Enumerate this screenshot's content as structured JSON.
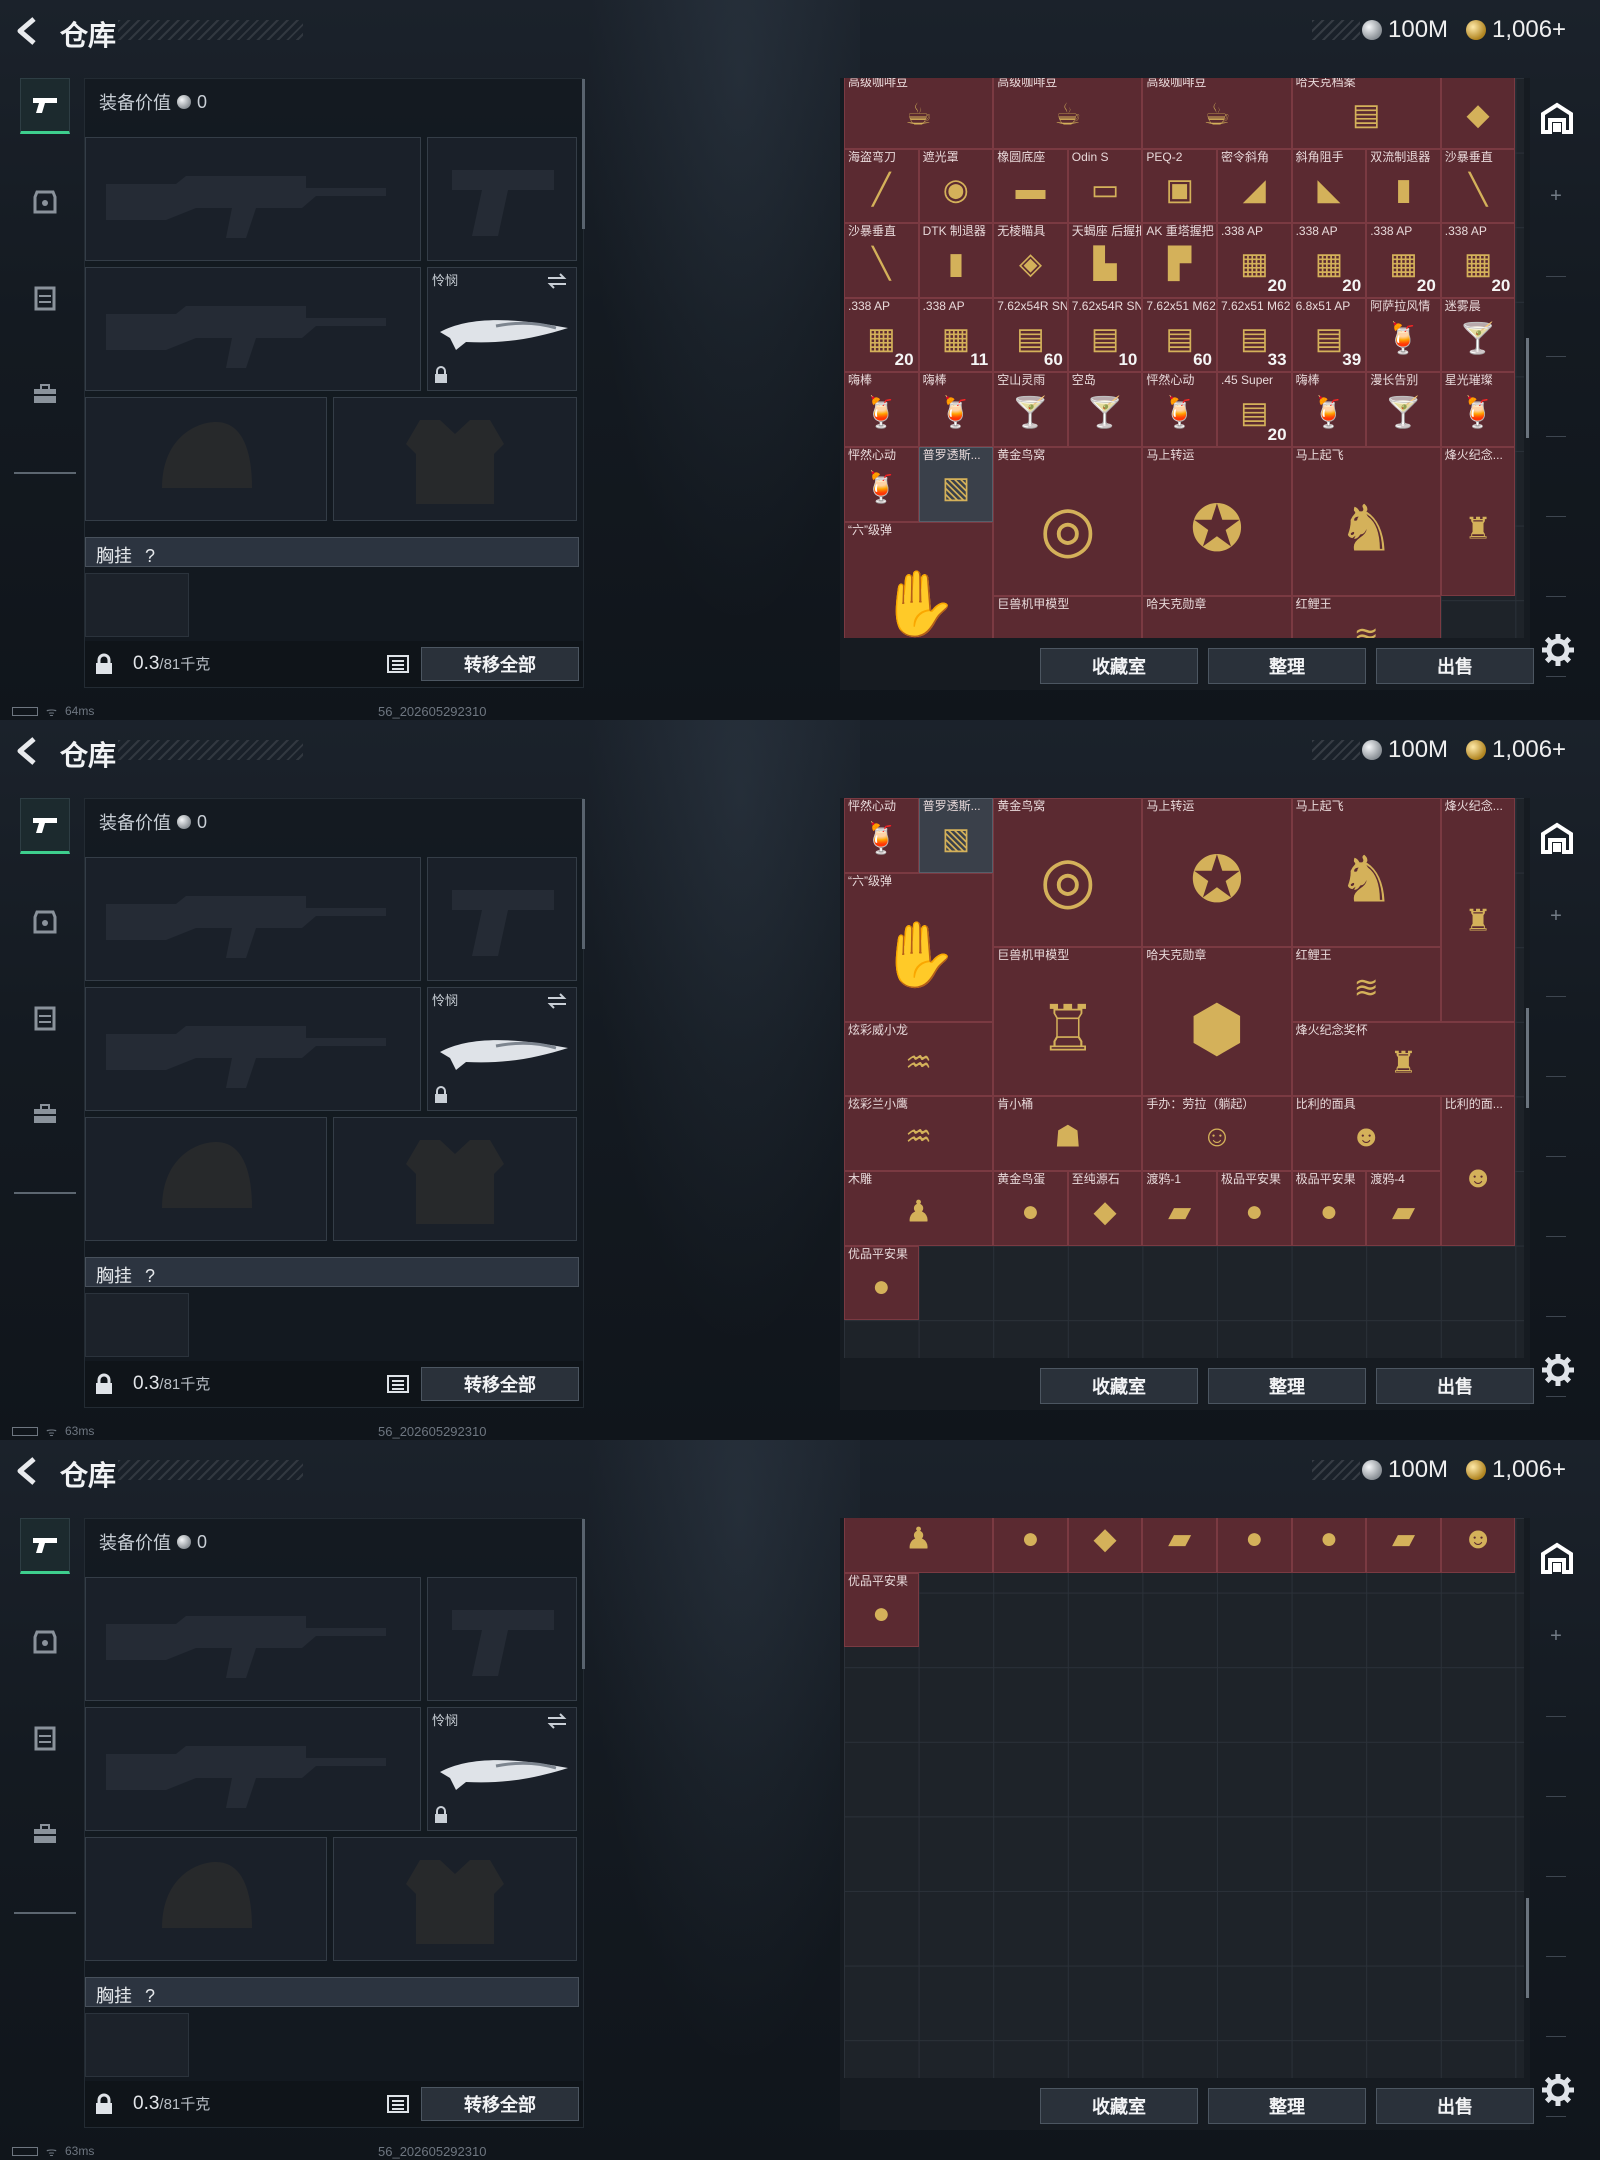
{
  "header": {
    "title": "仓库",
    "silver": "100M",
    "gold": "1,006+"
  },
  "equip": {
    "value_label": "装备价值",
    "value": "0",
    "melee_label": "怜悯",
    "chest_label": "胸挂",
    "chest_help": "?",
    "weight": "0.3",
    "weight_max": "/81千克",
    "transfer_all": "转移全部"
  },
  "buttons": {
    "collection": "收藏室",
    "organize": "整理",
    "sell": "出售"
  },
  "status": {
    "ping1": "64ms",
    "ping2": "63ms",
    "ping3": "63ms",
    "build": "56_202605292310"
  },
  "screens": [
    {
      "cells": [
        {
          "n": "高级咖啡豆",
          "c": "",
          "r": 0,
          "col": 0,
          "w": 2,
          "h": 1,
          "k": "☕"
        },
        {
          "n": "高级咖啡豆",
          "c": "",
          "r": 0,
          "col": 2,
          "w": 2,
          "h": 1,
          "k": "☕"
        },
        {
          "n": "高级咖啡豆",
          "c": "",
          "r": 0,
          "col": 4,
          "w": 2,
          "h": 1,
          "k": "☕"
        },
        {
          "n": "哈夫克档案",
          "c": "",
          "r": 0,
          "col": 6,
          "w": 2,
          "h": 1,
          "k": "▤"
        },
        {
          "n": "",
          "c": "",
          "r": 0,
          "col": 8,
          "w": 1,
          "h": 1,
          "k": "◆"
        },
        {
          "n": "海盗弯刀",
          "c": "",
          "r": 1,
          "col": 0,
          "w": 1,
          "h": 1,
          "k": "╱"
        },
        {
          "n": "遮光罩",
          "c": "",
          "r": 1,
          "col": 1,
          "w": 1,
          "h": 1,
          "k": "◉"
        },
        {
          "n": "橡圆底座",
          "c": "",
          "r": 1,
          "col": 2,
          "w": 1,
          "h": 1,
          "k": "▬"
        },
        {
          "n": "Odin S",
          "c": "",
          "r": 1,
          "col": 3,
          "w": 1,
          "h": 1,
          "k": "▭"
        },
        {
          "n": "PEQ-2",
          "c": "",
          "r": 1,
          "col": 4,
          "w": 1,
          "h": 1,
          "k": "▣"
        },
        {
          "n": "密令斜角",
          "c": "",
          "r": 1,
          "col": 5,
          "w": 1,
          "h": 1,
          "k": "◢"
        },
        {
          "n": "斜角阻手",
          "c": "",
          "r": 1,
          "col": 6,
          "w": 1,
          "h": 1,
          "k": "◣"
        },
        {
          "n": "双流制退器",
          "c": "",
          "r": 1,
          "col": 7,
          "w": 1,
          "h": 1,
          "k": "▮"
        },
        {
          "n": "沙暴垂直",
          "c": "",
          "r": 1,
          "col": 8,
          "w": 1,
          "h": 1,
          "k": "╲"
        },
        {
          "n": "沙暴垂直",
          "c": "",
          "r": 2,
          "col": 0,
          "w": 1,
          "h": 1,
          "k": "╲"
        },
        {
          "n": "DTK 制退器",
          "c": "",
          "r": 2,
          "col": 1,
          "w": 1,
          "h": 1,
          "k": "▮"
        },
        {
          "n": "无棱瞄具",
          "c": "",
          "r": 2,
          "col": 2,
          "w": 1,
          "h": 1,
          "k": "◈"
        },
        {
          "n": "天蝎座 后握把",
          "c": "",
          "r": 2,
          "col": 3,
          "w": 1,
          "h": 1,
          "k": "▙"
        },
        {
          "n": "AK 重塔握把",
          "c": "",
          "r": 2,
          "col": 4,
          "w": 1,
          "h": 1,
          "k": "▛"
        },
        {
          "n": ".338 AP",
          "c": "20",
          "r": 2,
          "col": 5,
          "w": 1,
          "h": 1,
          "k": "▦"
        },
        {
          "n": ".338 AP",
          "c": "20",
          "r": 2,
          "col": 6,
          "w": 1,
          "h": 1,
          "k": "▦"
        },
        {
          "n": ".338 AP",
          "c": "20",
          "r": 2,
          "col": 7,
          "w": 1,
          "h": 1,
          "k": "▦"
        },
        {
          "n": ".338 AP",
          "c": "20",
          "r": 2,
          "col": 8,
          "w": 1,
          "h": 1,
          "k": "▦"
        },
        {
          "n": ".338 AP",
          "c": "20",
          "r": 3,
          "col": 0,
          "w": 1,
          "h": 1,
          "k": "▦"
        },
        {
          "n": ".338 AP",
          "c": "11",
          "r": 3,
          "col": 1,
          "w": 1,
          "h": 1,
          "k": "▦"
        },
        {
          "n": "7.62x54R SNB",
          "c": "60",
          "r": 3,
          "col": 2,
          "w": 1,
          "h": 1,
          "k": "▤"
        },
        {
          "n": "7.62x54R SNB",
          "c": "10",
          "r": 3,
          "col": 3,
          "w": 1,
          "h": 1,
          "k": "▤"
        },
        {
          "n": "7.62x51 M62",
          "c": "60",
          "r": 3,
          "col": 4,
          "w": 1,
          "h": 1,
          "k": "▤"
        },
        {
          "n": "7.62x51 M62",
          "c": "33",
          "r": 3,
          "col": 5,
          "w": 1,
          "h": 1,
          "k": "▤"
        },
        {
          "n": "6.8x51 AP",
          "c": "39",
          "r": 3,
          "col": 6,
          "w": 1,
          "h": 1,
          "k": "▤"
        },
        {
          "n": "阿萨拉风情",
          "c": "",
          "r": 3,
          "col": 7,
          "w": 1,
          "h": 1,
          "k": "🍹"
        },
        {
          "n": "迷雾晨",
          "c": "",
          "r": 3,
          "col": 8,
          "w": 1,
          "h": 1,
          "k": "🍸"
        },
        {
          "n": "嗨棒",
          "c": "",
          "r": 4,
          "col": 0,
          "w": 1,
          "h": 1,
          "k": "🍹"
        },
        {
          "n": "嗨棒",
          "c": "",
          "r": 4,
          "col": 1,
          "w": 1,
          "h": 1,
          "k": "🍹"
        },
        {
          "n": "空山灵雨",
          "c": "",
          "r": 4,
          "col": 2,
          "w": 1,
          "h": 1,
          "k": "🍸"
        },
        {
          "n": "空岛",
          "c": "",
          "r": 4,
          "col": 3,
          "w": 1,
          "h": 1,
          "k": "🍸"
        },
        {
          "n": "怦然心动",
          "c": "",
          "r": 4,
          "col": 4,
          "w": 1,
          "h": 1,
          "k": "🍹"
        },
        {
          "n": ".45 Super",
          "c": "20",
          "r": 4,
          "col": 5,
          "w": 1,
          "h": 1,
          "k": "▤"
        },
        {
          "n": "嗨棒",
          "c": "",
          "r": 4,
          "col": 6,
          "w": 1,
          "h": 1,
          "k": "🍹"
        },
        {
          "n": "漫长告别",
          "c": "",
          "r": 4,
          "col": 7,
          "w": 1,
          "h": 1,
          "k": "🍸"
        },
        {
          "n": "星光璀璨",
          "c": "",
          "r": 4,
          "col": 8,
          "w": 1,
          "h": 1,
          "k": "🍹"
        },
        {
          "n": "怦然心动",
          "c": "",
          "r": 5,
          "col": 0,
          "w": 1,
          "h": 1,
          "k": "🍹"
        },
        {
          "n": "普罗透斯...",
          "c": "",
          "r": 5,
          "col": 1,
          "w": 1,
          "h": 1,
          "k": "▧",
          "g": true
        },
        {
          "n": "黄金鸟窝",
          "c": "",
          "r": 5,
          "col": 2,
          "w": 2,
          "h": 2,
          "k": "◎"
        },
        {
          "n": "马上转运",
          "c": "",
          "r": 5,
          "col": 4,
          "w": 2,
          "h": 2,
          "k": "✪"
        },
        {
          "n": "马上起飞",
          "c": "",
          "r": 5,
          "col": 6,
          "w": 2,
          "h": 2,
          "k": "♞"
        },
        {
          "n": "烽火纪念...",
          "c": "",
          "r": 5,
          "col": 8,
          "w": 1,
          "h": 2,
          "k": "♜"
        },
        {
          "n": "“六”级弹",
          "c": "",
          "r": 6,
          "col": 0,
          "w": 2,
          "h": 2,
          "k": "✋"
        },
        {
          "n": "巨兽机甲模型",
          "c": "",
          "r": 7,
          "col": 2,
          "w": 2,
          "h": 2,
          "k": "♖"
        },
        {
          "n": "哈夫克勋章",
          "c": "",
          "r": 7,
          "col": 4,
          "w": 2,
          "h": 2,
          "k": "⬢"
        },
        {
          "n": "红鲤王",
          "c": "",
          "r": 7,
          "col": 6,
          "w": 2,
          "h": 1,
          "k": "≋"
        }
      ]
    },
    {
      "cells": [
        {
          "n": "怦然心动",
          "c": "",
          "r": 0,
          "col": 0,
          "w": 1,
          "h": 1,
          "k": "🍹"
        },
        {
          "n": "普罗透斯...",
          "c": "",
          "r": 0,
          "col": 1,
          "w": 1,
          "h": 1,
          "k": "▧",
          "g": true
        },
        {
          "n": "黄金鸟窝",
          "c": "",
          "r": 0,
          "col": 2,
          "w": 2,
          "h": 2,
          "k": "◎"
        },
        {
          "n": "马上转运",
          "c": "",
          "r": 0,
          "col": 4,
          "w": 2,
          "h": 2,
          "k": "✪"
        },
        {
          "n": "马上起飞",
          "c": "",
          "r": 0,
          "col": 6,
          "w": 2,
          "h": 2,
          "k": "♞"
        },
        {
          "n": "烽火纪念...",
          "c": "",
          "r": 0,
          "col": 8,
          "w": 1,
          "h": 3,
          "k": "♜"
        },
        {
          "n": "“六”级弹",
          "c": "",
          "r": 1,
          "col": 0,
          "w": 2,
          "h": 2,
          "k": "✋"
        },
        {
          "n": "巨兽机甲模型",
          "c": "",
          "r": 2,
          "col": 2,
          "w": 2,
          "h": 2,
          "k": "♖"
        },
        {
          "n": "哈夫克勋章",
          "c": "",
          "r": 2,
          "col": 4,
          "w": 2,
          "h": 2,
          "k": "⬢"
        },
        {
          "n": "红鲤王",
          "c": "",
          "r": 2,
          "col": 6,
          "w": 2,
          "h": 1,
          "k": "≋"
        },
        {
          "n": "炫彩威小龙",
          "c": "",
          "r": 3,
          "col": 0,
          "w": 2,
          "h": 1,
          "k": "♒"
        },
        {
          "n": "烽火纪念奖杯",
          "c": "",
          "r": 3,
          "col": 6,
          "w": 3,
          "h": 1,
          "k": "♜"
        },
        {
          "n": "炫彩兰小鹰",
          "c": "",
          "r": 4,
          "col": 0,
          "w": 2,
          "h": 1,
          "k": "♒"
        },
        {
          "n": "肯小桶",
          "c": "",
          "r": 4,
          "col": 2,
          "w": 2,
          "h": 1,
          "k": "☗"
        },
        {
          "n": "手办：劳拉（躺起）",
          "c": "",
          "r": 4,
          "col": 4,
          "w": 2,
          "h": 1,
          "k": "☺"
        },
        {
          "n": "比利的面具",
          "c": "",
          "r": 4,
          "col": 6,
          "w": 2,
          "h": 1,
          "k": "☻"
        },
        {
          "n": "比利的面...",
          "c": "",
          "r": 4,
          "col": 8,
          "w": 1,
          "h": 2,
          "k": "☻"
        },
        {
          "n": "木雕",
          "c": "",
          "r": 5,
          "col": 0,
          "w": 2,
          "h": 1,
          "k": "♟"
        },
        {
          "n": "黄金鸟蛋",
          "c": "",
          "r": 5,
          "col": 2,
          "w": 1,
          "h": 1,
          "k": "●"
        },
        {
          "n": "至纯源石",
          "c": "",
          "r": 5,
          "col": 3,
          "w": 1,
          "h": 1,
          "k": "◆"
        },
        {
          "n": "渡鸦-1",
          "c": "",
          "r": 5,
          "col": 4,
          "w": 1,
          "h": 1,
          "k": "▰"
        },
        {
          "n": "极品平安果",
          "c": "",
          "r": 5,
          "col": 5,
          "w": 1,
          "h": 1,
          "k": "●"
        },
        {
          "n": "极品平安果",
          "c": "",
          "r": 5,
          "col": 6,
          "w": 1,
          "h": 1,
          "k": "●"
        },
        {
          "n": "渡鸦-4",
          "c": "",
          "r": 5,
          "col": 7,
          "w": 1,
          "h": 1,
          "k": "▰"
        },
        {
          "n": "优品平安果",
          "c": "",
          "r": 6,
          "col": 0,
          "w": 1,
          "h": 1,
          "k": "●"
        }
      ]
    },
    {
      "cells": [
        {
          "n": "",
          "c": "",
          "r": 0,
          "col": 0,
          "w": 2,
          "h": 1,
          "k": "♟"
        },
        {
          "n": "",
          "c": "",
          "r": 0,
          "col": 2,
          "w": 1,
          "h": 1,
          "k": "●"
        },
        {
          "n": "",
          "c": "",
          "r": 0,
          "col": 3,
          "w": 1,
          "h": 1,
          "k": "◆"
        },
        {
          "n": "",
          "c": "",
          "r": 0,
          "col": 4,
          "w": 1,
          "h": 1,
          "k": "▰"
        },
        {
          "n": "",
          "c": "",
          "r": 0,
          "col": 5,
          "w": 1,
          "h": 1,
          "k": "●"
        },
        {
          "n": "",
          "c": "",
          "r": 0,
          "col": 6,
          "w": 1,
          "h": 1,
          "k": "●"
        },
        {
          "n": "",
          "c": "",
          "r": 0,
          "col": 7,
          "w": 1,
          "h": 1,
          "k": "▰"
        },
        {
          "n": "",
          "c": "",
          "r": 0,
          "col": 8,
          "w": 1,
          "h": 1,
          "k": "☻"
        },
        {
          "n": "优品平安果",
          "c": "",
          "r": 1,
          "col": 0,
          "w": 1,
          "h": 1,
          "k": "●"
        }
      ]
    }
  ]
}
